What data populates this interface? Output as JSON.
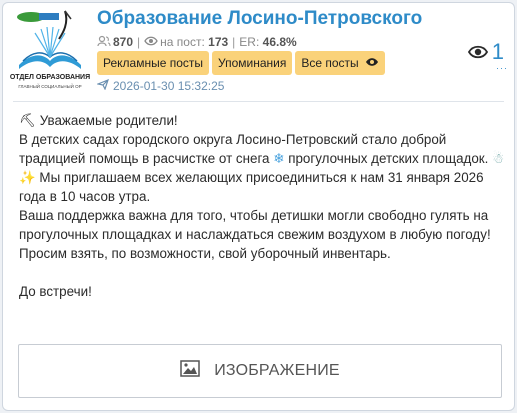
{
  "channel": {
    "title": "Образование Лосино-Петровского",
    "logo_text_top": "ОТДЕЛ ОБРАЗОВАНИЯ",
    "logo_text_bottom": "ГЛАВНЫЙ СОЦИАЛЬНЫЙ ОР"
  },
  "stats": {
    "subscribers": "870",
    "reach_label": "на пост:",
    "reach_value": "173",
    "er_label": "ER:",
    "er_value": "46.8%"
  },
  "buttons": {
    "ads": "Рекламные посты",
    "mentions": "Упоминания",
    "all_posts": "Все посты"
  },
  "post": {
    "date": "2026-01-30 15:32:25",
    "views": "1",
    "lines": [
      "Уважаемые родители!",
      "В детских садах городского округа Лосино-Петровский стало доброй традицией помощь в расчистке от снега",
      "прогулочных детских площадок.",
      "Мы приглашаем всех желающих присоединиться к нам 31 января 2026 года в 10 часов утра.",
      "Ваша поддержка важна для того, чтобы детишки могли свободно гулять на прогулочных площадках и наслаждаться свежим воздухом в любую погоду!",
      "Просим взять, по возможности, свой уборочный инвентарь.",
      "До встречи!"
    ],
    "media_label": "ИЗОБРАЖЕНИЕ"
  },
  "colors": {
    "accent": "#2e8bc8",
    "button_bg": "#fad27a"
  },
  "icons": [
    "subscribers-icon",
    "eye-icon",
    "send-icon",
    "image-icon",
    "shovel-emoji",
    "snowflake-emoji",
    "snowman-emoji",
    "sparkles-emoji"
  ]
}
